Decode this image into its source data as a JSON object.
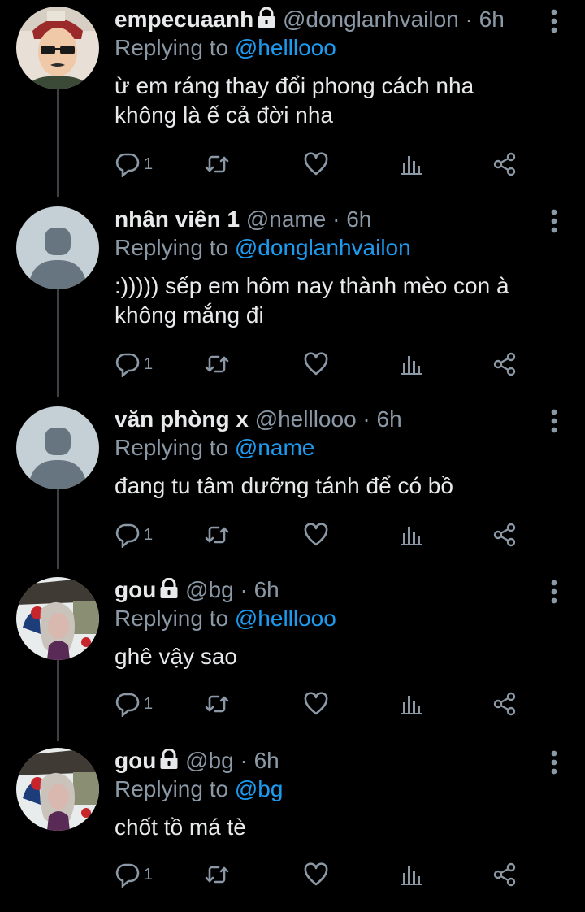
{
  "colors": {
    "background": "#000000",
    "text": "#e7e9ea",
    "muted": "#8b98a5",
    "link": "#1d9bf0",
    "thread": "#3d4146"
  },
  "reply_prefix": "Replying to",
  "tweets": [
    {
      "name": "empecuaanh",
      "locked": true,
      "handle": "@donglanhvailon",
      "dot": "·",
      "time": "6h",
      "reply_to": "@helllooo",
      "lines": [
        "ừ em ráng thay đổi phong cách nha",
        "không là ế cả đời nha"
      ],
      "reply_count": "1",
      "avatar": "photo-sunglasses-icon"
    },
    {
      "name": "nhân viên 1",
      "locked": false,
      "handle": "@name",
      "dot": "·",
      "time": "6h",
      "reply_to": "@donglanhvailon",
      "lines": [
        ":))))) sếp em hôm nay thành mèo con à",
        "không mắng đi"
      ],
      "reply_count": "1",
      "avatar": "default-avatar-icon"
    },
    {
      "name": "văn phòng x",
      "locked": false,
      "handle": "@helllooo",
      "dot": "·",
      "time": "6h",
      "reply_to": "@name",
      "lines": [
        "đang tu tâm dưỡng tánh để có bồ"
      ],
      "reply_count": "1",
      "avatar": "default-avatar-icon"
    },
    {
      "name": "gou",
      "locked": true,
      "handle": "@bg",
      "dot": "·",
      "time": "6h",
      "reply_to": "@helllooo",
      "lines": [
        "ghê vậy sao"
      ],
      "reply_count": "1",
      "avatar": "cartoon-witch-icon"
    },
    {
      "name": "gou",
      "locked": true,
      "handle": "@bg",
      "dot": "·",
      "time": "6h",
      "reply_to": "@bg",
      "lines": [
        "chốt tồ má tè"
      ],
      "reply_count": "1",
      "avatar": "cartoon-witch-icon"
    }
  ]
}
